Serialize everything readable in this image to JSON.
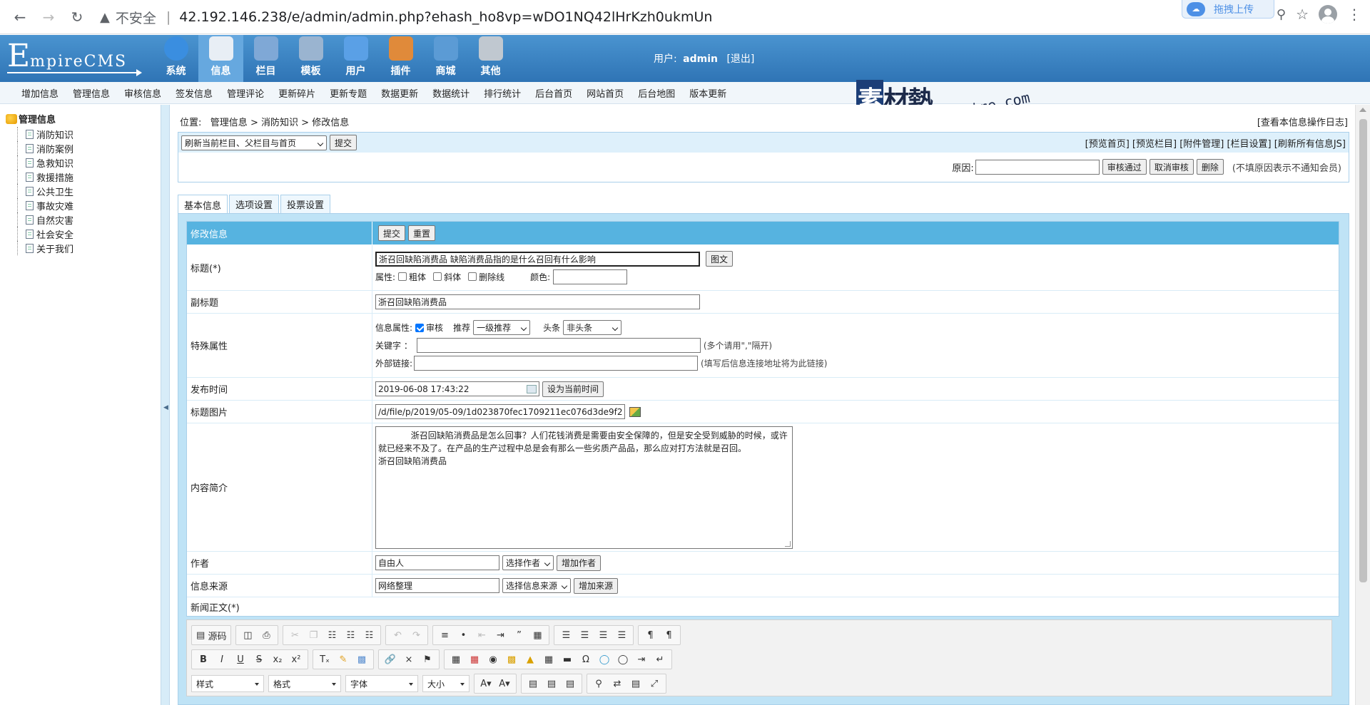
{
  "browser": {
    "insecure_label": "不安全",
    "url": "42.192.146.238/e/admin/admin.php?ehash_ho8vp=wDO1NQ42lHrKzh0ukmUn",
    "upload_label": "拖拽上传"
  },
  "header": {
    "logo_big": "E",
    "logo_rest": "mpireCMS",
    "nav": [
      {
        "label": "系统",
        "icon": "globe-icon",
        "color": "#3a8ee0"
      },
      {
        "label": "信息",
        "icon": "note-icon",
        "color": "#e8eef5"
      },
      {
        "label": "栏目",
        "icon": "folder-icon",
        "color": "#7fa8d6"
      },
      {
        "label": "模板",
        "icon": "template-icon",
        "color": "#9ab4d0"
      },
      {
        "label": "用户",
        "icon": "user-icon",
        "color": "#5aa0e6"
      },
      {
        "label": "插件",
        "icon": "tools-icon",
        "color": "#e08a3a"
      },
      {
        "label": "商城",
        "icon": "card-icon",
        "color": "#5b9bd5"
      },
      {
        "label": "其他",
        "icon": "gear-icon",
        "color": "#c0c8d0"
      }
    ],
    "user_prefix": "用户:",
    "username": "admin",
    "logout": "[退出]"
  },
  "subnav": [
    "增加信息",
    "管理信息",
    "审核信息",
    "签发信息",
    "管理评论",
    "更新碎片",
    "更新专题",
    "数据更新",
    "数据统计",
    "排行统计",
    "后台首页",
    "网站首页",
    "后台地图",
    "版本更新"
  ],
  "watermark": {
    "cn_block": "素",
    "cn_rest": "材熱",
    "en": "sucaire.com"
  },
  "tree": {
    "root": "管理信息",
    "items": [
      "消防知识",
      "消防案例",
      "急救知识",
      "救援措施",
      "公共卫生",
      "事故灾难",
      "自然灾害",
      "社会安全",
      "关于我们"
    ]
  },
  "location": {
    "prefix": "位置:",
    "crumb1": "管理信息",
    "sep1": ">",
    "crumb2": "消防知识",
    "sep2": ">",
    "current": "修改信息",
    "log_link": "[查看本信息操作日志]"
  },
  "actions": {
    "refresh_select": "刷新当前栏目、父栏目与首页",
    "submit": "提交",
    "links": "[预览首页] [预览栏目] [附件管理] [栏目设置] [刷新所有信息JS]",
    "reason_label": "原因:",
    "approve": "审核通过",
    "cancel_approve": "取消审核",
    "delete": "删除",
    "reason_hint": "(不填原因表示不通知会员)"
  },
  "tabs": [
    "基本信息",
    "选项设置",
    "投票设置"
  ],
  "form": {
    "header_label": "修改信息",
    "submit": "提交",
    "reset": "重置",
    "title_label": "标题(*)",
    "title_value": "浙召回缺陷消费品 缺陷消费品指的是什么召回有什么影响",
    "title_image_btn": "图文",
    "attr_label": "属性:",
    "bold": "粗体",
    "italic": "斜体",
    "strike": "删除线",
    "color_label": "颜色:",
    "subtitle_label": "副标题",
    "subtitle_value": "浙召回缺陷消费品",
    "special_label": "特殊属性",
    "info_attr_label": "信息属性:",
    "audit": "审核",
    "recommend_label": "推荐",
    "recommend_value": "一级推荐",
    "headline_label": "头条",
    "headline_value": "非头条",
    "keyword_label": "关键字 ：",
    "keyword_hint": "(多个请用\",\"隔开)",
    "extlink_label": "外部链接:",
    "extlink_hint": "(填写后信息连接地址将为此链接)",
    "pubtime_label": "发布时间",
    "pubtime_value": "2019-06-08 17:43:22",
    "pubtime_btn": "设为当前时间",
    "titleimg_label": "标题图片",
    "titleimg_value": "/d/file/p/2019/05-09/1d023870fec1709211ec076d3de9f2",
    "summary_label": "内容简介",
    "summary_value": "            浙召回缺陷消费品是怎么回事？人们花钱消费是需要由安全保障的，但是安全受到威胁的时候，或许就已经来不及了。在产品的生产过程中总是会有那么一些劣质产品品，那么应对打方法就是召回。             浙召回缺陷消费品",
    "author_label": "作者",
    "author_value": "自由人",
    "author_select": "选择作者",
    "author_add": "增加作者",
    "source_label": "信息来源",
    "source_value": "网络整理",
    "source_select": "选择信息来源",
    "source_add": "增加来源",
    "body_label": "新闻正文(*)"
  },
  "editor": {
    "source": "源码",
    "combos": [
      "样式",
      "格式",
      "字体",
      "大小"
    ]
  }
}
